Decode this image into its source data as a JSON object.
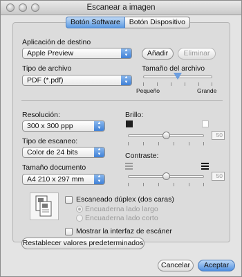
{
  "window": {
    "title": "Escanear a imagen"
  },
  "tabs": [
    {
      "label": "Botón Software",
      "active": true
    },
    {
      "label": "Botón Dispositivo",
      "active": false
    }
  ],
  "destination": {
    "label": "Aplicación de destino",
    "app_value": "Apple Preview",
    "add_button": "Añadir",
    "remove_button": "Eliminar"
  },
  "file_type": {
    "label": "Tipo de archivo",
    "value": "PDF (*.pdf)"
  },
  "file_size": {
    "label": "Tamaño del archivo",
    "min_label": "Pequeño",
    "max_label": "Grande",
    "level_fraction": 0.5
  },
  "resolution": {
    "label": "Resolución:",
    "value": "300 x 300 ppp"
  },
  "scan_type": {
    "label": "Tipo de escaneo:",
    "value": "Color de 24 bits"
  },
  "document_size": {
    "label": "Tamaño documento",
    "value": "A4  210 x 297 mm"
  },
  "brightness": {
    "label": "Brillo:",
    "value": "50",
    "level_fraction": 0.5
  },
  "contrast": {
    "label": "Contraste:",
    "value": "50",
    "level_fraction": 0.5
  },
  "duplex": {
    "label": "Escaneado dúplex (dos caras)",
    "checked": false,
    "option_long": "Encuaderna lado largo",
    "option_short": "Encuaderna lado corto"
  },
  "show_interface": {
    "label": "Mostrar la interfaz de escáner",
    "checked": false
  },
  "footer": {
    "reset_button": "Restablecer valores predeterminados",
    "cancel_button": "Cancelar",
    "accept_button": "Aceptar"
  },
  "colors": {
    "accent": "#5c9be3",
    "window_bg": "#e4e4e4"
  }
}
